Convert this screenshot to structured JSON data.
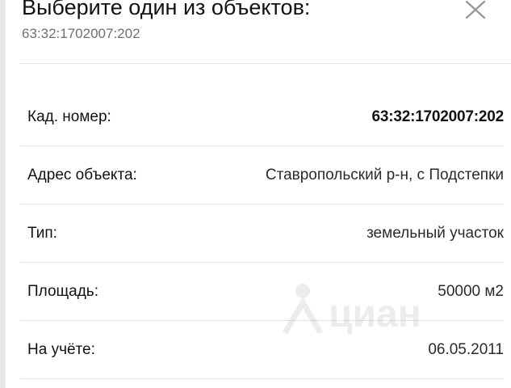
{
  "modal": {
    "title": "Выберите один из объектов:",
    "subtitle": "63:32:1702007:202",
    "close_icon": "close-icon"
  },
  "details": [
    {
      "label": "Кад. номер:",
      "value": "63:32:1702007:202"
    },
    {
      "label": "Адрес объекта:",
      "value": "Ставропольский р-н, с Подстепки"
    },
    {
      "label": "Тип:",
      "value": "земельный участок"
    },
    {
      "label": "Площадь:",
      "value": "50000 м2"
    },
    {
      "label": "На учёте:",
      "value": "06.05.2011"
    }
  ],
  "watermark": {
    "text": "циан"
  },
  "colors": {
    "background": "#ffffff",
    "text": "#121212",
    "muted": "#6f6f6f",
    "divider": "#e6e6e6"
  }
}
